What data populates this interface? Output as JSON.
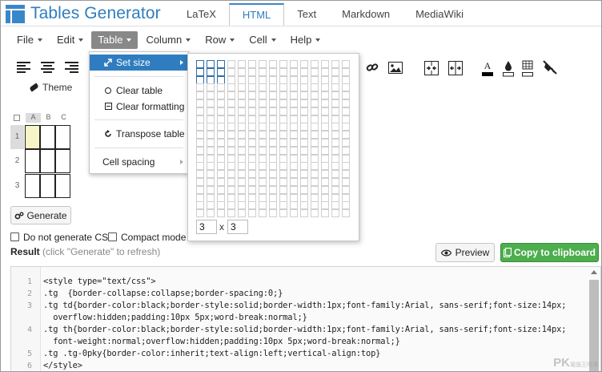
{
  "app": {
    "title": "Tables Generator"
  },
  "tabs": [
    "LaTeX",
    "HTML",
    "Text",
    "Markdown",
    "MediaWiki"
  ],
  "active_tab": "HTML",
  "menubar": [
    "File",
    "Edit",
    "Table",
    "Column",
    "Row",
    "Cell",
    "Help"
  ],
  "active_menu": "Table",
  "toolbar": {
    "theme_label": "Theme"
  },
  "table_menu": {
    "items": {
      "set_size": "Set size",
      "clear_table": "Clear table",
      "clear_formatting": "Clear formatting",
      "transpose_table": "Transpose table",
      "cell_spacing": "Cell spacing"
    }
  },
  "size_picker": {
    "rows": "3",
    "cols": "3",
    "separator": "x",
    "max_rows": 20,
    "max_cols": 15
  },
  "mini_table": {
    "columns": [
      "A",
      "B",
      "C"
    ],
    "rows": [
      "1",
      "2",
      "3"
    ]
  },
  "buttons": {
    "generate": "Generate",
    "preview": "Preview",
    "copy": "Copy to clipboard"
  },
  "options": {
    "no_css": "Do not generate CSS",
    "compact": "Compact mode"
  },
  "result": {
    "label": "Result",
    "hint": "(click \"Generate\" to refresh)"
  },
  "code": {
    "line_numbers": [
      "1",
      "2",
      "3",
      "",
      "4",
      "",
      "5",
      "6"
    ],
    "lines": [
      "<style type=\"text/css\">",
      ".tg  {border-collapse:collapse;border-spacing:0;}",
      ".tg td{border-color:black;border-style:solid;border-width:1px;font-family:Arial, sans-serif;font-size:14px;",
      "  overflow:hidden;padding:10px 5px;word-break:normal;}",
      ".tg th{border-color:black;border-style:solid;border-width:1px;font-family:Arial, sans-serif;font-size:14px;",
      "  font-weight:normal;overflow:hidden;padding:10px 5px;word-break:normal;}",
      ".tg .tg-0pky{border-color:inherit;text-align:left;vertical-align:top}",
      "</style>"
    ]
  },
  "watermark": {
    "main": "PK",
    "small": "電腦王阿達"
  },
  "colors": {
    "accent": "#2f7dc0",
    "copy_button": "#4cae4c",
    "selected_cell": "#f7f4c8"
  }
}
